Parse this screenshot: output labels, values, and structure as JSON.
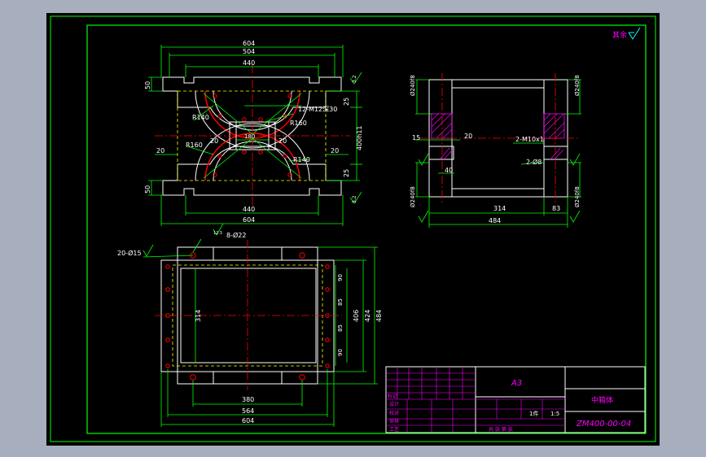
{
  "colors": {
    "background": "#a7aebd",
    "sheet": "#000000",
    "border": "#00ff00",
    "geometry": "#ffffff",
    "dimension": "#00ff00",
    "center": "#ff0000",
    "hidden": "#ffff00",
    "title_block": "#ff00ff",
    "annotation": "#00ffff"
  },
  "roughness_mark": "其余",
  "front_view": {
    "dims_top": [
      "604",
      "504",
      "440"
    ],
    "dims_bottom": [
      "440",
      "604"
    ],
    "dims_left": [
      "50",
      "20",
      "20",
      "50"
    ],
    "dims_right": [
      "25",
      "400h11",
      "25"
    ],
    "label_r140_top": "R140",
    "label_r140_bottom": "R140",
    "label_r160_top": "R160",
    "label_r160_bottom": "R160",
    "label_center": "180",
    "label_threads": "12-M12深30",
    "label_20a": "20",
    "label_20b": "20",
    "roughness_top": "3.2",
    "roughness_bottom": "3.2"
  },
  "side_view": {
    "dia_top_left": "Ø240f8",
    "dia_top_right": "Ø240f8",
    "dia_bottom_left": "Ø240f8",
    "dia_bottom_right": "Ø240f8",
    "dim_15": "15",
    "dim_20": "20",
    "dim_40": "40",
    "dim_314": "314",
    "dim_83": "83",
    "dim_484": "484",
    "label_threads": "2-M10x1",
    "label_holes": "2-Ø8",
    "roughness_a": "3.2",
    "roughness_b": "3.2"
  },
  "top_view": {
    "label_holes_a": "20-Ø15",
    "label_holes_b": "8-Ø22",
    "dim_314": "314",
    "dims_right": [
      "90",
      "85",
      "85",
      "90"
    ],
    "dim_406": "406",
    "dim_424": "424",
    "dim_484": "484",
    "dim_380": "380",
    "dim_564": "564",
    "dim_604": "604",
    "roughness": "12.5"
  },
  "title_block": {
    "material": "A3",
    "part_name": "中箱体",
    "drawing_no": "ZM400-00-04",
    "scale": "1:5",
    "quantity": "1件",
    "rows": [
      "标记",
      "设计",
      "校对",
      "审核",
      "工艺"
    ],
    "sheet": "共  张  第  张"
  }
}
